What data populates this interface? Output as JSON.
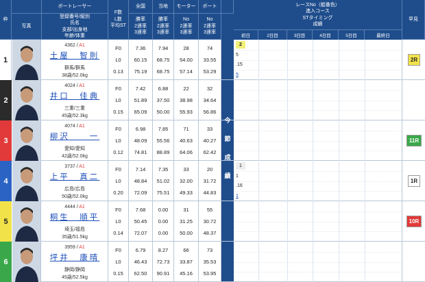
{
  "headers": {
    "lane": "枠",
    "photo": "写真",
    "boat_racer": "ボートレーサー",
    "racer_lines": [
      "登録番号/級別",
      "氏名",
      "支部/出身地",
      "年齢/体重"
    ],
    "fstats_lines": [
      "F数",
      "L数",
      "平均ST"
    ],
    "national": "全国",
    "local": "当地",
    "motor": "モーター",
    "boat": "ボート",
    "rate_lines": [
      "勝率",
      "2連率",
      "3連率"
    ],
    "no_lines": [
      "No",
      "2連率",
      "3連率"
    ],
    "race_lines": [
      "レースNo（艇番色）",
      "進入コース",
      "STタイミング",
      "成績"
    ],
    "days": [
      "初日",
      "2日目",
      "3日目",
      "4日目",
      "5日目",
      "最終日"
    ],
    "prediction": "早見",
    "konsetsu": [
      "今",
      "節",
      "成",
      "績"
    ]
  },
  "colors": {
    "header_bg": "#1f4d8c",
    "lanes": [
      "#ffffff",
      "#2b2b2b",
      "#e23a3a",
      "#2b63c5",
      "#f2e24a",
      "#3aa84a"
    ],
    "lane_text": [
      "#222222",
      "#ffffff",
      "#ffffff",
      "#ffffff",
      "#222222",
      "#ffffff"
    ]
  },
  "racers": [
    {
      "lane": "1",
      "reg": "4362",
      "cls": "A1",
      "name": "土屋　智則",
      "branch": "群馬/群馬",
      "age_weight": "38歳/52.0kg",
      "f": "F0",
      "l": "L0",
      "st": "0.13",
      "n_win": "7.36",
      "n_2": "60.15",
      "n_3": "75.19",
      "l_win": "7.94",
      "l_2": "68.75",
      "l_3": "68.75",
      "m_no": "28",
      "m_2": "54.00",
      "m_3": "57.14",
      "b_no": "74",
      "b_2": "33.55",
      "b_3": "53.29",
      "race": [
        "2",
        "5",
        ".15",
        "5"
      ],
      "pred": "2R",
      "pred_color": "#f2e24a",
      "pred_text": "#222222"
    },
    {
      "lane": "2",
      "reg": "4024",
      "cls": "A1",
      "name": "井口　佳典",
      "branch": "三重/三重",
      "age_weight": "45歳/52.3kg",
      "f": "F0",
      "l": "L0",
      "st": "0.15",
      "n_win": "7.42",
      "n_2": "51.89",
      "n_3": "65.09",
      "l_win": "6.88",
      "l_2": "37.50",
      "l_3": "50.00",
      "m_no": "22",
      "m_2": "38.98",
      "m_3": "55.93",
      "b_no": "32",
      "b_2": "34.64",
      "b_3": "56.86",
      "race": [],
      "pred": "",
      "pred_color": "",
      "pred_text": ""
    },
    {
      "lane": "3",
      "reg": "4074",
      "cls": "A1",
      "name": "柳沢　　一",
      "branch": "愛知/愛知",
      "age_weight": "42歳/52.0kg",
      "f": "F0",
      "l": "L0",
      "st": "0.12",
      "n_win": "6.98",
      "n_2": "48.09",
      "n_3": "74.81",
      "l_win": "7.85",
      "l_2": "55.56",
      "l_3": "88.89",
      "m_no": "71",
      "m_2": "40.63",
      "m_3": "64.06",
      "b_no": "33",
      "b_2": "40.27",
      "b_3": "62.42",
      "race": [],
      "pred": "11R",
      "pred_color": "#3aa84a",
      "pred_text": "#ffffff"
    },
    {
      "lane": "4",
      "reg": "3737",
      "cls": "A1",
      "name": "上平　真二",
      "branch": "広島/広島",
      "age_weight": "50歳/52.0kg",
      "f": "F0",
      "l": "L0",
      "st": "0.20",
      "n_win": "7.14",
      "n_2": "48.84",
      "n_3": "72.09",
      "l_win": "7.35",
      "l_2": "51.02",
      "l_3": "75.51",
      "m_no": "33",
      "m_2": "32.00",
      "m_3": "49.33",
      "b_no": "20",
      "b_2": "31.72",
      "b_3": "44.83",
      "race": [
        "1",
        "1",
        ".16",
        "1"
      ],
      "pred": "1R",
      "pred_color": "#ffffff",
      "pred_text": "#222222"
    },
    {
      "lane": "5",
      "reg": "4444",
      "cls": "A1",
      "name": "桐生　順平",
      "branch": "埼玉/福島",
      "age_weight": "35歳/51.5kg",
      "f": "F0",
      "l": "L0",
      "st": "0.14",
      "n_win": "7.68",
      "n_2": "50.45",
      "n_3": "72.07",
      "l_win": "0.00",
      "l_2": "0.00",
      "l_3": "0.00",
      "m_no": "31",
      "m_2": "31.25",
      "m_3": "50.00",
      "b_no": "55",
      "b_2": "30.72",
      "b_3": "48.37",
      "race": [],
      "pred": "10R",
      "pred_color": "#e23a3a",
      "pred_text": "#ffffff"
    },
    {
      "lane": "6",
      "reg": "3959",
      "cls": "A1",
      "name": "坪井　康晴",
      "branch": "静岡/静岡",
      "age_weight": "45歳/52.5kg",
      "f": "F0",
      "l": "L0",
      "st": "0.15",
      "n_win": "6.79",
      "n_2": "46.43",
      "n_3": "62.50",
      "l_win": "8.27",
      "l_2": "72.73",
      "l_3": "90.91",
      "m_no": "66",
      "m_2": "33.87",
      "m_3": "45.16",
      "b_no": "73",
      "b_2": "35.53",
      "b_3": "53.95",
      "race": [],
      "pred": "",
      "pred_color": "",
      "pred_text": ""
    }
  ]
}
